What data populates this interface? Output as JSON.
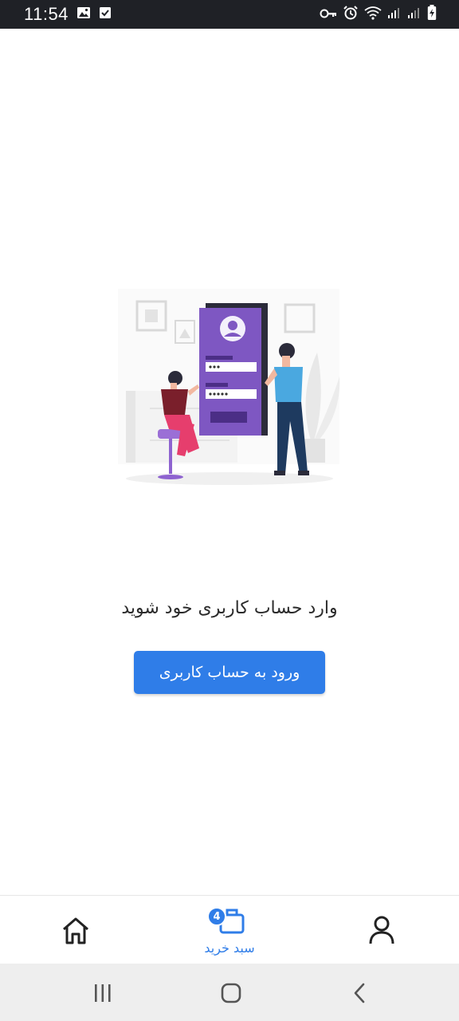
{
  "status_bar": {
    "time": "11:54",
    "left_icons": [
      "image-icon",
      "checkbox-icon"
    ],
    "right_icons": [
      "vpn-key-icon",
      "alarm-icon",
      "wifi-icon",
      "signal-icon",
      "signal-icon",
      "battery-charging-icon"
    ]
  },
  "main": {
    "message": "وارد حساب کاربری خود شوید",
    "login_button_label": "ورود به حساب کاربری"
  },
  "bottom_nav": {
    "cart_label": "سبد خرید",
    "cart_badge": "4",
    "items": [
      "home-icon",
      "cart-icon",
      "profile-icon"
    ]
  },
  "system_nav": {
    "items": [
      "recents-icon",
      "home-circle-icon",
      "back-icon"
    ]
  },
  "colors": {
    "accent": "#2f7de8",
    "status_bar_bg": "#1f2126",
    "illustration_purple": "#7e57c2"
  }
}
